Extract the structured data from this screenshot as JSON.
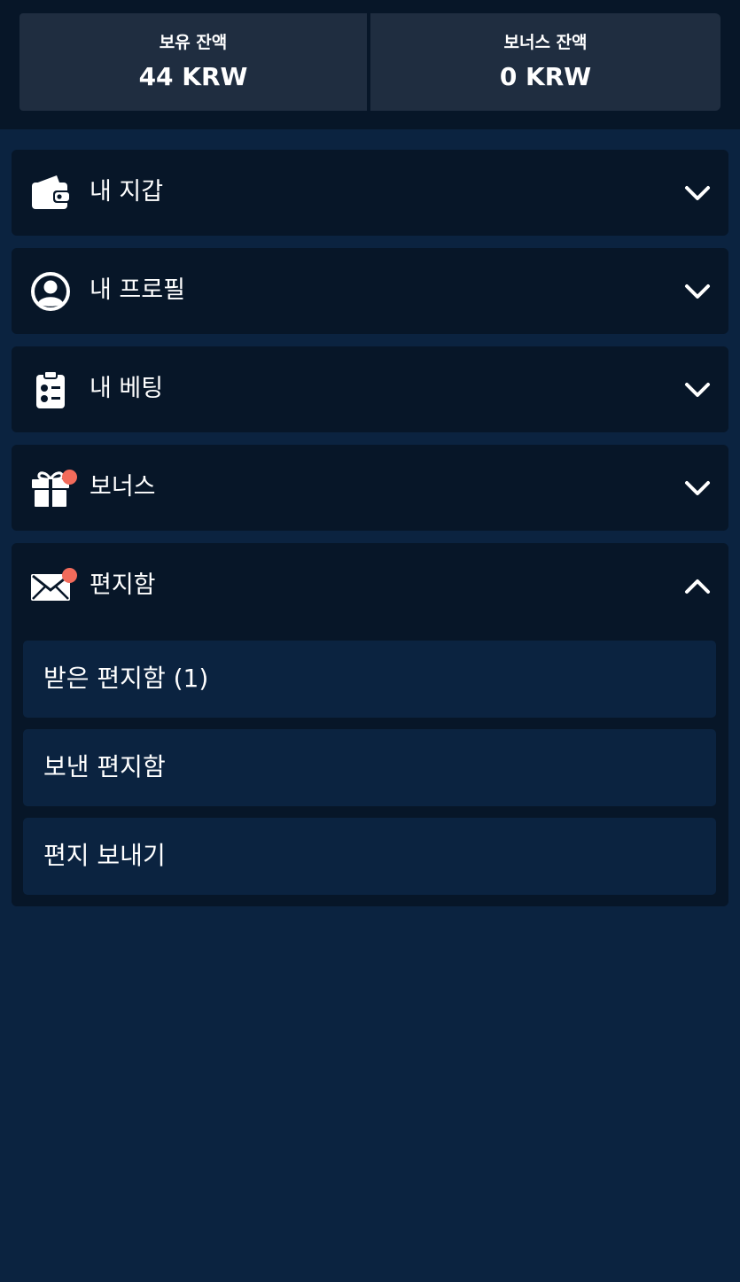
{
  "balances": {
    "held": {
      "label": "보유 잔액",
      "value": "44 KRW"
    },
    "bonus": {
      "label": "보너스 잔액",
      "value": "0 KRW"
    }
  },
  "menu": [
    {
      "label": "내 지갑",
      "icon": "wallet-icon",
      "expanded": false,
      "notification": false
    },
    {
      "label": "내 프로필",
      "icon": "user-circle-icon",
      "expanded": false,
      "notification": false
    },
    {
      "label": "내 베팅",
      "icon": "betting-clipboard-icon",
      "expanded": false,
      "notification": false
    },
    {
      "label": "보너스",
      "icon": "gift-icon",
      "expanded": false,
      "notification": true
    },
    {
      "label": "편지함",
      "icon": "envelope-icon",
      "expanded": true,
      "notification": true,
      "sub_items": [
        {
          "label": "받은 편지함 (1)"
        },
        {
          "label": "보낸 편지함"
        },
        {
          "label": "편지 보내기"
        }
      ]
    }
  ],
  "colors": {
    "page_background": "#0b2340",
    "panel_background": "#071628",
    "balance_box": "#1f2d40",
    "notification_dot": "#f26b5b",
    "text": "#ffffff"
  }
}
